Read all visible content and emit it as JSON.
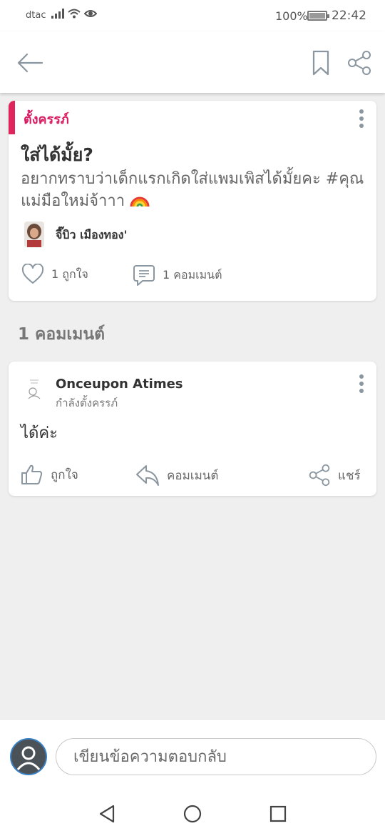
{
  "status_bar": {
    "carrier": "dtac",
    "battery": "100%",
    "time": "22:42"
  },
  "app_bar": {
    "back_icon": "arrow-left-icon",
    "bookmark_icon": "bookmark-icon",
    "share_icon": "share-icon"
  },
  "post": {
    "category": "ตั้งครรภ์",
    "title": "ใส่ได้มั้ย?",
    "body": "อยากทราบว่าเด็กแรกเกิดใส่แพมเพิสได้มั้ยคะ #คุณแม่มือใหม่จ้าาา",
    "emoji_icon": "rainbow-icon",
    "author": "จี๊บิว เมืองทอง'",
    "likes_label": "1 ถูกใจ",
    "comments_label": "1 คอมเมนต์"
  },
  "comments_section": {
    "title": "1 คอมเมนต์"
  },
  "comment": {
    "author": "Onceupon Atimes",
    "status": "กำลังตั้งครรภ์",
    "text": "ได้ค่ะ",
    "like_label": "ถูกใจ",
    "reply_label": "คอมเมนต์",
    "share_label": "แชร์"
  },
  "reply": {
    "placeholder": "เขียนข้อความตอบกลับ"
  },
  "colors": {
    "accent": "#d81b60",
    "icon_gray": "#8a96a0"
  }
}
